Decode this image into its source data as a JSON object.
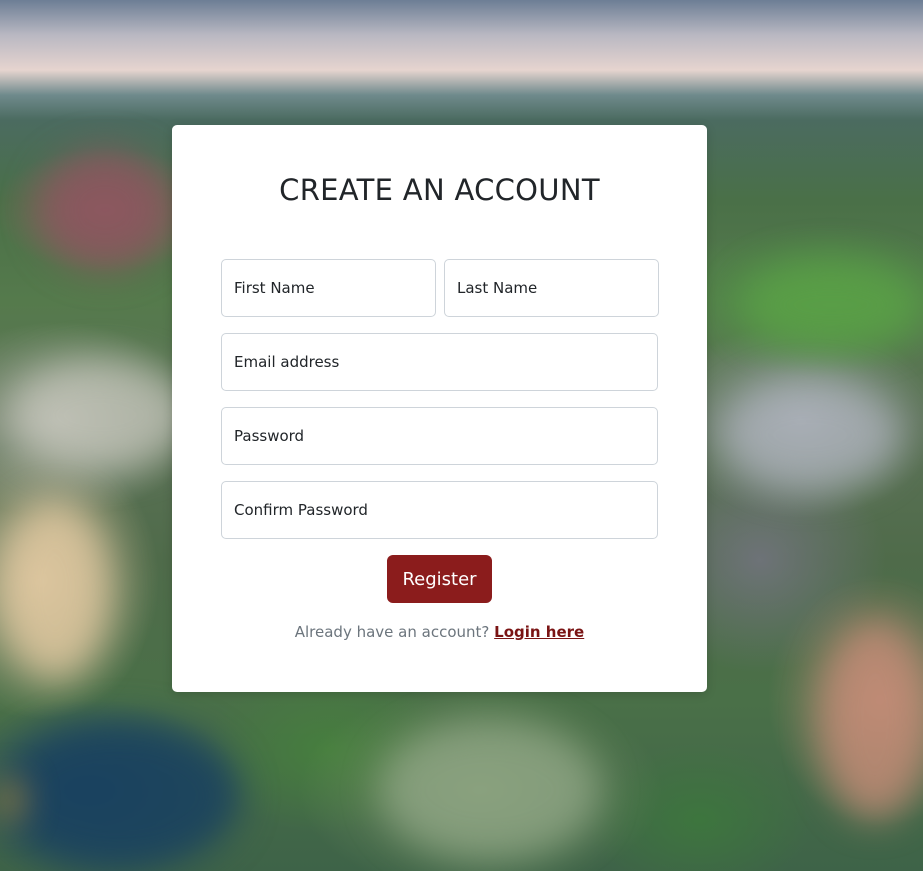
{
  "form": {
    "title": "CREATE AN ACCOUNT",
    "fields": {
      "first_name": {
        "placeholder": "First Name",
        "value": ""
      },
      "last_name": {
        "placeholder": "Last Name",
        "value": ""
      },
      "email": {
        "placeholder": "Email address",
        "value": ""
      },
      "password": {
        "placeholder": "Password",
        "value": ""
      },
      "confirm_password": {
        "placeholder": "Confirm Password",
        "value": ""
      }
    },
    "register_label": "Register",
    "login_prompt": "Already have an account?",
    "login_link": "Login here"
  },
  "colors": {
    "brand": "#8b1c1c",
    "link": "#7a1414",
    "card_background": "#ffffff",
    "text": "#212529",
    "muted_text": "#6c757d"
  }
}
